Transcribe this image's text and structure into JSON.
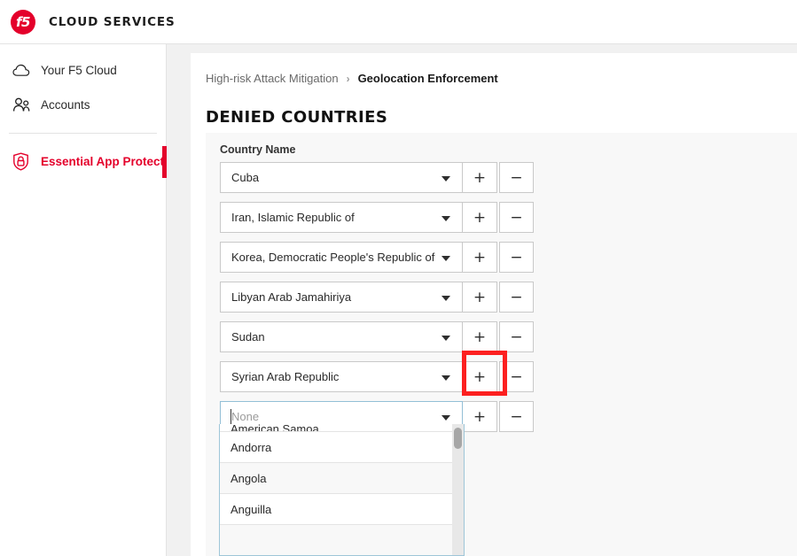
{
  "brand": {
    "logo_icon": "f5-logo-icon",
    "logo_text": "f5",
    "title": "CLOUD SERVICES"
  },
  "sidebar": {
    "items": [
      {
        "icon": "cloud-icon",
        "label": "Your F5 Cloud",
        "active": false
      },
      {
        "icon": "accounts-icon",
        "label": "Accounts",
        "active": false
      },
      {
        "icon": "shield-lock-icon",
        "label": "Essential App Protect",
        "active": true
      }
    ]
  },
  "breadcrumb": {
    "parent": "High-risk Attack Mitigation",
    "separator": "›",
    "current": "Geolocation Enforcement"
  },
  "main": {
    "page_title": "DENIED COUNTRIES",
    "column_header": "Country Name",
    "add_label": "+",
    "remove_label": "−",
    "rows": [
      {
        "value": "Cuba",
        "placeholder": "None",
        "focused": false
      },
      {
        "value": "Iran, Islamic Republic of",
        "placeholder": "None",
        "focused": false
      },
      {
        "value": "Korea, Democratic People's Republic of",
        "placeholder": "None",
        "focused": false
      },
      {
        "value": "Libyan Arab Jamahiriya",
        "placeholder": "None",
        "focused": false
      },
      {
        "value": "Sudan",
        "placeholder": "None",
        "focused": false
      },
      {
        "value": "Syrian Arab Republic",
        "placeholder": "None",
        "focused": false
      },
      {
        "value": "",
        "placeholder": "None",
        "focused": true
      }
    ]
  },
  "dropdown": {
    "open": true,
    "options": [
      "American Samoa",
      "Andorra",
      "Angola",
      "Anguilla",
      ""
    ]
  },
  "annotation": {
    "highlight_color": "#fc2020",
    "target": "add-button-row-6"
  },
  "colors": {
    "brand_red": "#e4002b",
    "page_bg": "#f1f1f1",
    "card_bg": "#f8f8f8",
    "focus_border": "#9ec6d8"
  }
}
